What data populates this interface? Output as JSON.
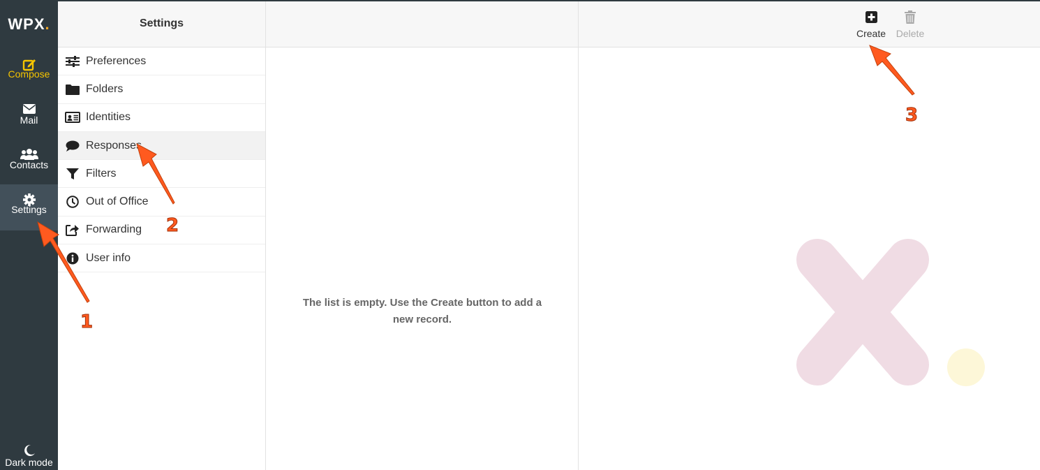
{
  "app": {
    "logo": "WPX",
    "logo_dot": "."
  },
  "nav": {
    "compose": "Compose",
    "mail": "Mail",
    "contacts": "Contacts",
    "settings": "Settings",
    "dark_mode": "Dark mode"
  },
  "settings": {
    "title": "Settings",
    "items": [
      {
        "label": "Preferences",
        "icon": "sliders-icon"
      },
      {
        "label": "Folders",
        "icon": "folder-icon"
      },
      {
        "label": "Identities",
        "icon": "id-card-icon"
      },
      {
        "label": "Responses",
        "icon": "comment-icon"
      },
      {
        "label": "Filters",
        "icon": "filter-icon"
      },
      {
        "label": "Out of Office",
        "icon": "clock-icon"
      },
      {
        "label": "Forwarding",
        "icon": "share-icon"
      },
      {
        "label": "User info",
        "icon": "info-icon"
      }
    ],
    "active": "Responses"
  },
  "list": {
    "empty_message": "The list is empty. Use the Create button to add a new record."
  },
  "toolbar": {
    "create_label": "Create",
    "delete_label": "Delete"
  },
  "annotations": {
    "step1": "1",
    "step2": "2",
    "step3": "3"
  },
  "colors": {
    "nav_bg": "#2f3a40",
    "accent_yellow": "#f5c400",
    "arrow": "#ff5a1f",
    "watermark_pink": "#f0dce4",
    "watermark_yellow": "#fdf7d8"
  }
}
